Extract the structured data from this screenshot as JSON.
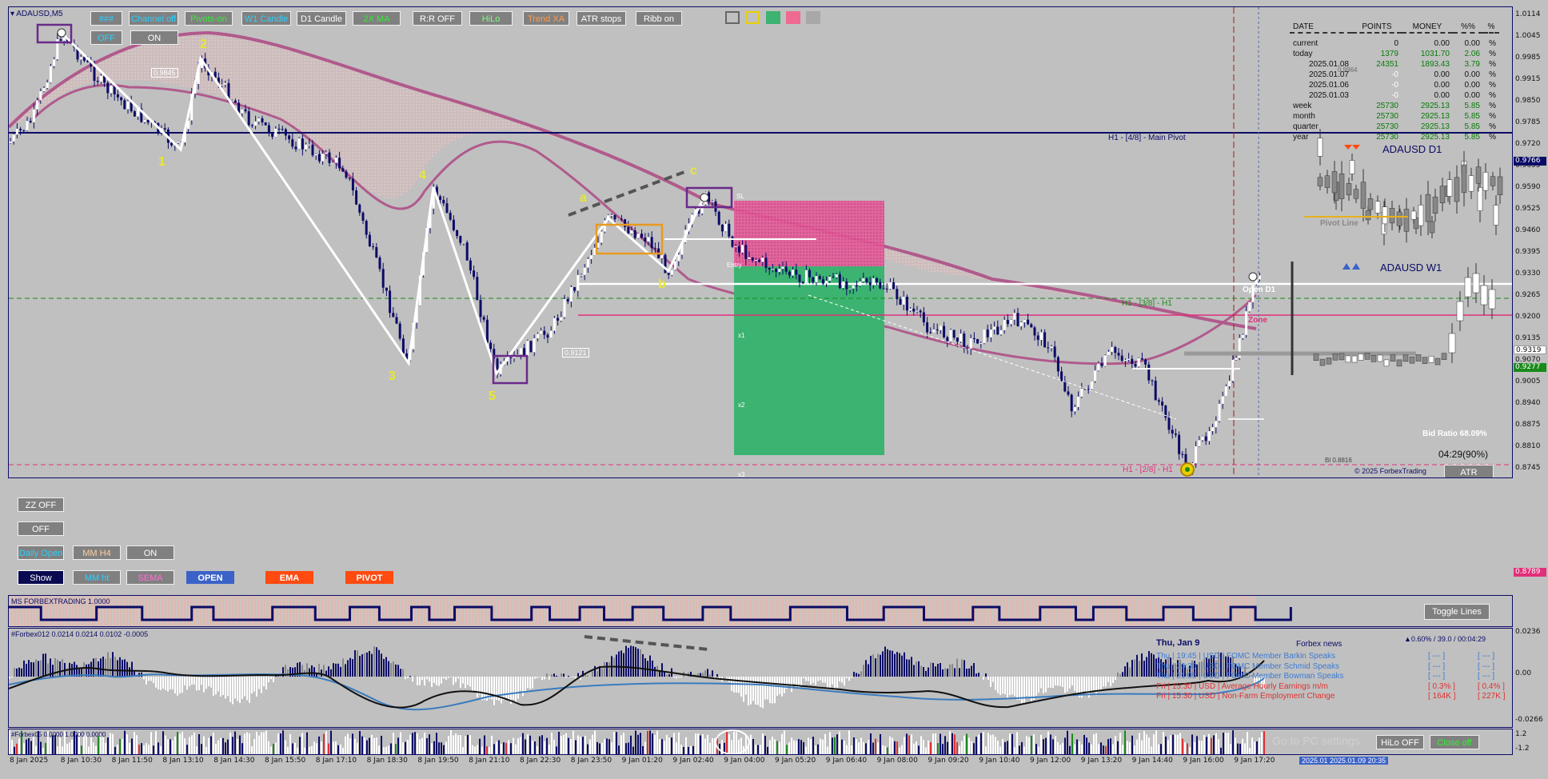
{
  "symbol": "ADAUSD,M5",
  "top_buttons": [
    "###",
    "Channel off",
    "Pivots-on",
    "W1 Candle",
    "D1 Candle",
    "2X MA",
    "R:R OFF",
    "HiLo",
    "Trend XA",
    "ATR stops",
    "Ribb on"
  ],
  "sub_buttons": [
    "OFF",
    "ON"
  ],
  "left_buttons": {
    "zz": "ZZ OFF",
    "off": "OFF",
    "daily_open": "Daily Open",
    "mm_h4": "MM H4",
    "on": "ON",
    "show": "Show",
    "mm_ht": "MM ht",
    "sema": "SEMA",
    "open": "OPEN",
    "ema": "EMA",
    "pivot": "PIVOT"
  },
  "colors": {
    "bg": "#c0c0c0",
    "bull": "#ffffff",
    "bear": "#0b0b66",
    "ma": "#b05a8c",
    "tp_zone": "#3cb371",
    "sl_zone": "#ee6a90",
    "pivot_line": "#0b0b66"
  },
  "wave_labels": [
    "1",
    "2",
    "3",
    "4",
    "5",
    "a",
    "b",
    "c"
  ],
  "chart_annotations": {
    "price_0_9845": "0.9845",
    "price_0_9121": "0.9121",
    "main_pivot": "H1 - [4/8] - Main Pivot",
    "h1_38": "H1 - [3/8] - H1",
    "h1_28": "H1 - [2/8] - H1",
    "open_d1": "Open D1",
    "zone": "Zone",
    "sl": "SL",
    "entry": "Entry",
    "x1": "x1",
    "x2": "x2",
    "x3": "x3",
    "pivot_line": "Pivot Line",
    "bid_ratio": "Bid Ratio 68.09%",
    "timer": "04:29(90%)",
    "copyright": "© 2025 ForbexTrading",
    "atr_btn": "ATR",
    "small_val": "0.9964",
    "bi_val": "Bl 0.8816"
  },
  "mini_charts": {
    "d1": "ADAUSD D1",
    "w1": "ADAUSD W1"
  },
  "stats": {
    "headers": [
      "DATE",
      "POINTS",
      "MONEY",
      "%%",
      "%"
    ],
    "rows": [
      [
        "current",
        "0",
        "0.00",
        "0.00",
        "%"
      ],
      [
        "today",
        "1379",
        "1031.70",
        "2.06",
        "%"
      ],
      [
        "2025.01.08",
        "24351",
        "1893.43",
        "3.79",
        "%"
      ],
      [
        "2025.01.07",
        "-0",
        "0.00",
        "0.00",
        "%"
      ],
      [
        "2025.01.06",
        "-0",
        "0.00",
        "0.00",
        "%"
      ],
      [
        "2025.01.03",
        "-0",
        "0.00",
        "0.00",
        "%"
      ],
      [
        "week",
        "25730",
        "2925.13",
        "5.85",
        "%"
      ],
      [
        "month",
        "25730",
        "2925.13",
        "5.85",
        "%"
      ],
      [
        "quarter",
        "25730",
        "2925.13",
        "5.85",
        "%"
      ],
      [
        "year",
        "25730",
        "2925.13",
        "5.85",
        "%"
      ]
    ]
  },
  "price_axis": [
    "1.0114",
    "1.0045",
    "0.9985",
    "0.9915",
    "0.9850",
    "0.9785",
    "0.9720",
    "0.9655",
    "0.9590",
    "0.9525",
    "0.9460",
    "0.9395",
    "0.9330",
    "0.9265",
    "0.9200",
    "0.9135",
    "0.9070",
    "0.9005",
    "0.8940",
    "0.8875",
    "0.8810",
    "0.8745"
  ],
  "price_tags": {
    "p0_9766": "0.9766",
    "p0_9319": "0.9319",
    "p0_9277": "0.9277",
    "p0_8789": "0.8789"
  },
  "ind1": {
    "title": "MS FORBEXTRADING 1.0000",
    "toggle": "Toggle Lines"
  },
  "ind2": {
    "title": "#Forbex012 0.0214 0.0214 0.0102 -0.0005",
    "axis": [
      "0.0236",
      "0.00",
      "-0.0266"
    ],
    "news_date": "Thu, Jan 9",
    "news_title": "Forbex news",
    "news_stats": "▲0.60% / 39.0 / 00:04:29",
    "news": [
      {
        "text": "Thu  |  19:45  |  USD  |  FOMC Member Barkin Speaks",
        "a": "[ --- ]",
        "b": "[ --- ]",
        "color": "#3a7bd5"
      },
      {
        "text": "Thu  |  20:30  |  USD  |  FOMC Member Schmid Speaks",
        "a": "[ --- ]",
        "b": "[ --- ]",
        "color": "#3a7bd5"
      },
      {
        "text": "Thu  |  21:05  |  USD  |  FOMC Member Bowman Speaks",
        "a": "[ --- ]",
        "b": "[ --- ]",
        "color": "#3a7bd5"
      },
      {
        "text": "Fri  |  15:30  |  USD  |  Average Hourly Earnings m/m",
        "a": "[ 0.3% ]",
        "b": "[ 0.4% ]",
        "color": "#e03030"
      },
      {
        "text": "Fri  |  15:30  |  USD  |  Non-Farm Employment Change",
        "a": "[ 164K ]",
        "b": "[ 227K ]",
        "color": "#e03030"
      }
    ]
  },
  "ind3": {
    "title": "#Forbex05 0.0000 1.0000 0.0000",
    "axis": [
      "1.2",
      "-1.2"
    ],
    "hilo": "HiLo OFF",
    "close": "Close off",
    "watermark": "Go to PC settings"
  },
  "time_axis": [
    "8 Jan 2025",
    "8 Jan 10:30",
    "8 Jan 11:50",
    "8 Jan 13:10",
    "8 Jan 14:30",
    "8 Jan 15:50",
    "8 Jan 17:10",
    "8 Jan 18:30",
    "8 Jan 19:50",
    "8 Jan 21:10",
    "8 Jan 22:30",
    "8 Jan 23:50",
    "9 Jan 01:20",
    "9 Jan 02:40",
    "9 Jan 04:00",
    "9 Jan 05:20",
    "9 Jan 06:40",
    "9 Jan 08:00",
    "9 Jan 09:20",
    "9 Jan 10:40",
    "9 Jan 12:00",
    "9 Jan 13:20",
    "9 Jan 14:40",
    "9 Jan 16:00",
    "9 Jan 17:20"
  ],
  "time_tag": "2025.01  2025.01.09 20:35"
}
